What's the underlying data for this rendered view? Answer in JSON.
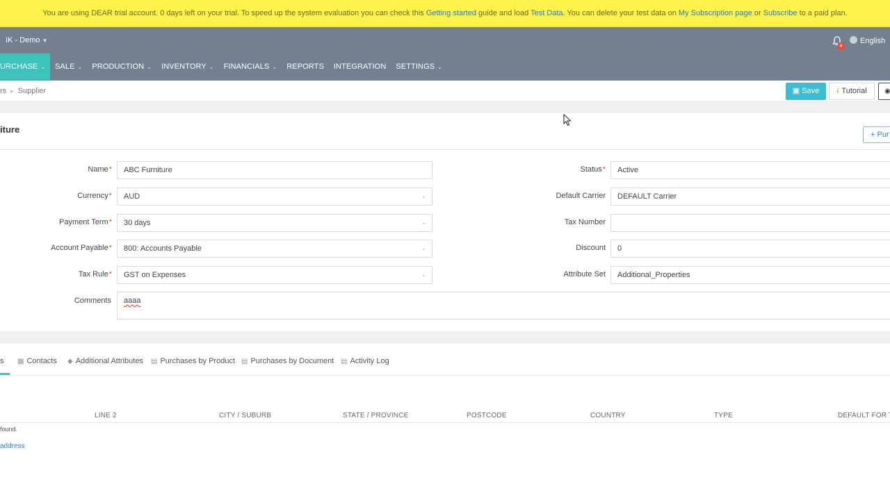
{
  "banner": {
    "t1": "You are using DEAR trial account. 0 days left on your trial. To speed up the system evaluation you can check this ",
    "link1": "Getting started",
    "t2": " guide and load ",
    "link2": "Test Data",
    "t3": ". You can delete your test data on ",
    "link3": "My Subscription page",
    "t4": " or ",
    "link4": "Subscribe",
    "t5": " to a paid plan."
  },
  "header": {
    "company": "IK - Demo",
    "notification_count": "4",
    "language": "English"
  },
  "nav": [
    {
      "label": "URCHASE",
      "dropdown": true
    },
    {
      "label": "SALE",
      "dropdown": true
    },
    {
      "label": "PRODUCTION",
      "dropdown": true
    },
    {
      "label": "INVENTORY",
      "dropdown": true
    },
    {
      "label": "FINANCIALS",
      "dropdown": true
    },
    {
      "label": "REPORTS",
      "dropdown": false
    },
    {
      "label": "INTEGRATION",
      "dropdown": false
    },
    {
      "label": "SETTINGS",
      "dropdown": true
    }
  ],
  "breadcrumb": {
    "prev": "rs",
    "current": "Supplier"
  },
  "toolbar": {
    "save_label": "Save",
    "tutorial_label": "Tutorial"
  },
  "form": {
    "title": "iture",
    "purchase_button": "Pur",
    "fields": {
      "name": {
        "label": "Name",
        "value": "ABC Furniture"
      },
      "currency": {
        "label": "Currency",
        "value": "AUD"
      },
      "payment_term": {
        "label": "Payment Term",
        "value": "30 days"
      },
      "account_payable": {
        "label": "Account Payable",
        "value": "800: Accounts Payable"
      },
      "tax_rule": {
        "label": "Tax Rule",
        "value": "GST on Expenses"
      },
      "comments": {
        "label": "Comments",
        "value": "aaaa"
      },
      "status": {
        "label": "Status",
        "value": "Active"
      },
      "default_carrier": {
        "label": "Default Carrier",
        "value": "DEFAULT Carrier"
      },
      "tax_number": {
        "label": "Tax Number",
        "value": ""
      },
      "discount": {
        "label": "Discount",
        "value": "0"
      },
      "attribute_set": {
        "label": "Attribute Set",
        "value": "Additional_Properties"
      }
    }
  },
  "tabs": [
    {
      "label": "s"
    },
    {
      "label": "Contacts"
    },
    {
      "label": "Additional Attributes"
    },
    {
      "label": "Purchases by Product"
    },
    {
      "label": "Purchases by Document"
    },
    {
      "label": "Activity Log"
    }
  ],
  "address_table": {
    "columns": [
      "LINE 2",
      "CITY / SUBURB",
      "STATE / PROVINCE",
      "POSTCODE",
      "COUNTRY",
      "TYPE",
      "DEFAULT FOR TY"
    ],
    "empty_message": "found.",
    "add_link": "address"
  }
}
